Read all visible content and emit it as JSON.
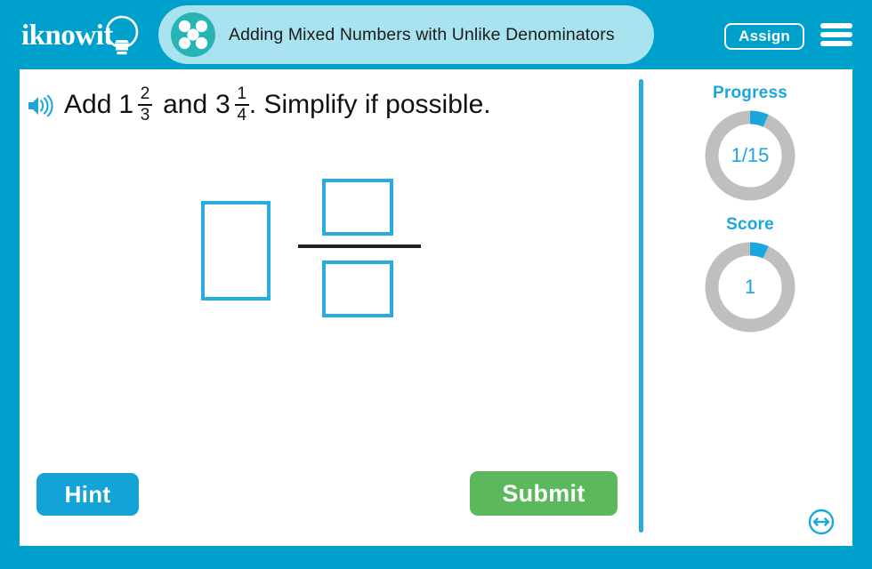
{
  "header": {
    "logo_text": "iknowit",
    "logo_icon": "lightbulb-icon",
    "title": "Adding Mixed Numbers with Unlike Denominators",
    "title_icon": "five-dots-circle-icon",
    "assign_label": "Assign",
    "menu_icon": "hamburger-menu-icon",
    "bar_color": "#00a0cc",
    "pill_color": "#a8e3ef",
    "title_icon_color": "#29b4b4"
  },
  "question": {
    "speaker_icon": "speaker-audio-icon",
    "prefix": "Add",
    "operand1": {
      "whole": "1",
      "numerator": "2",
      "denominator": "3"
    },
    "conjunction": "and",
    "operand2": {
      "whole": "3",
      "numerator": "1",
      "denominator": "4"
    },
    "suffix": ". Simplify if possible.",
    "full_text": "Add 1 2/3 and 3 1/4. Simplify if possible."
  },
  "answer": {
    "whole_value": "",
    "whole_placeholder": "",
    "numerator_value": "",
    "numerator_placeholder": "",
    "denominator_value": "",
    "denominator_placeholder": "",
    "box_border_color": "#29abe2",
    "fraction_bar_color": "#231f20"
  },
  "footer": {
    "hint_label": "Hint",
    "hint_color": "#14a3d6",
    "submit_label": "Submit",
    "submit_color": "#5cb85c",
    "resize_icon": "resize-horizontal-icon"
  },
  "sidebar": {
    "progress": {
      "label": "Progress",
      "value": "1/15",
      "completed": 1,
      "total": 15,
      "percent": 6.7
    },
    "score": {
      "label": "Score",
      "value": "1",
      "percent": 6.7
    },
    "ring_track_color": "#bfbfbf",
    "ring_fill_color": "#1ba7dd",
    "label_color": "#1ba7dd"
  }
}
